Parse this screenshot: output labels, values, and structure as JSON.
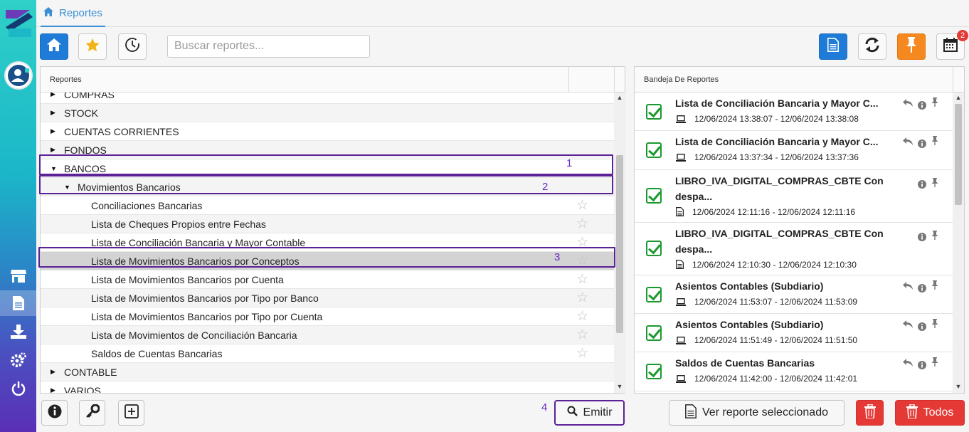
{
  "breadcrumb": {
    "label": "Reportes",
    "icon": "home-icon"
  },
  "search": {
    "placeholder": "Buscar reportes..."
  },
  "notifications": {
    "count": "2"
  },
  "left_panel": {
    "header": "Reportes",
    "rows": [
      {
        "label": "COMPRAS",
        "level": 0,
        "expanded": false,
        "star": false
      },
      {
        "label": "STOCK",
        "level": 0,
        "expanded": false,
        "star": false
      },
      {
        "label": "CUENTAS CORRIENTES",
        "level": 0,
        "expanded": false,
        "star": false
      },
      {
        "label": "FONDOS",
        "level": 0,
        "expanded": false,
        "star": false
      },
      {
        "label": "BANCOS",
        "level": 0,
        "expanded": true,
        "star": false
      },
      {
        "label": "Movimientos Bancarios",
        "level": 1,
        "expanded": true,
        "star": false
      },
      {
        "label": "Conciliaciones Bancarias",
        "level": 2,
        "star": true
      },
      {
        "label": "Lista de Cheques Propios entre Fechas",
        "level": 2,
        "star": true
      },
      {
        "label": "Lista de Conciliación Bancaria y Mayor Contable",
        "level": 2,
        "star": true
      },
      {
        "label": "Lista de Movimientos Bancarios por Conceptos",
        "level": 2,
        "star": true,
        "selected": true
      },
      {
        "label": "Lista de Movimientos Bancarios por Cuenta",
        "level": 2,
        "star": true
      },
      {
        "label": "Lista de Movimientos Bancarios por Tipo por Banco",
        "level": 2,
        "star": true
      },
      {
        "label": "Lista de Movimientos Bancarios por Tipo por Cuenta",
        "level": 2,
        "star": true
      },
      {
        "label": "Lista de Movimientos de Conciliación Bancaria",
        "level": 2,
        "star": true
      },
      {
        "label": "Saldos de Cuentas Bancarias",
        "level": 2,
        "star": true
      },
      {
        "label": "CONTABLE",
        "level": 0,
        "expanded": false,
        "star": false
      },
      {
        "label": "VARIOS",
        "level": 0,
        "expanded": false,
        "star": false
      }
    ],
    "annotations": [
      "1",
      "2",
      "3",
      "4"
    ]
  },
  "right_panel": {
    "header": "Bandeja De Reportes",
    "items": [
      {
        "title": "Lista de Conciliación Bancaria y Mayor C...",
        "dates": "12/06/2024 13:38:07 - 12/06/2024 13:38:08",
        "icon": "laptop-icon",
        "reply": true
      },
      {
        "title": "Lista de Conciliación Bancaria y Mayor C...",
        "dates": "12/06/2024 13:37:34 - 12/06/2024 13:37:36",
        "icon": "laptop-icon",
        "reply": true
      },
      {
        "title": "LIBRO_IVA_DIGITAL_COMPRAS_CBTE Con despa...",
        "dates": "12/06/2024 12:11:16 - 12/06/2024 12:11:16",
        "icon": "file-icon",
        "reply": false
      },
      {
        "title": "LIBRO_IVA_DIGITAL_COMPRAS_CBTE Con despa...",
        "dates": "12/06/2024 12:10:30 - 12/06/2024 12:10:30",
        "icon": "file-icon",
        "reply": false
      },
      {
        "title": "Asientos Contables (Subdiario)",
        "dates": "12/06/2024 11:53:07 - 12/06/2024 11:53:09",
        "icon": "laptop-icon",
        "reply": true
      },
      {
        "title": "Asientos Contables (Subdiario)",
        "dates": "12/06/2024 11:51:49 - 12/06/2024 11:51:50",
        "icon": "laptop-icon",
        "reply": true
      },
      {
        "title": "Saldos de Cuentas Bancarias",
        "dates": "12/06/2024 11:42:00 - 12/06/2024 11:42:01",
        "icon": "laptop-icon",
        "reply": true
      }
    ]
  },
  "buttons": {
    "emitir": "Emitir",
    "ver_reporte": "Ver reporte seleccionado",
    "todos": "Todos"
  },
  "colors": {
    "accent": "#1e7bd8",
    "highlight": "#5c2196",
    "danger": "#e53935",
    "pin": "#f5891f",
    "check": "#1a9a2e"
  }
}
